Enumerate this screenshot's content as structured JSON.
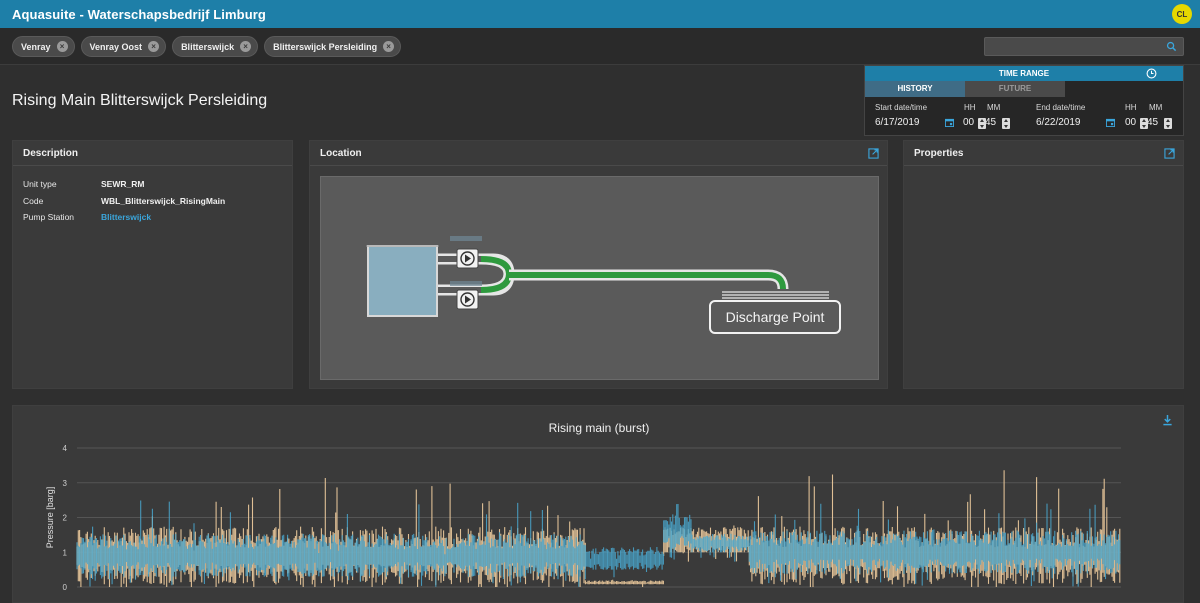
{
  "app": {
    "title": "Aquasuite - Waterschapsbedrijf Limburg",
    "user_initials": "CL"
  },
  "filters": {
    "chips": [
      "Venray",
      "Venray Oost",
      "Blitterswijck",
      "Blitterswijck Persleiding"
    ],
    "search_placeholder": ""
  },
  "page": {
    "title": "Rising Main Blitterswijck Persleiding"
  },
  "time_range": {
    "header": "TIME RANGE",
    "tabs": [
      "HISTORY",
      "FUTURE"
    ],
    "active_tab": "HISTORY",
    "start_label": "Start date/time",
    "end_label": "End date/time",
    "hh_label": "HH",
    "mm_label": "MM",
    "start_date": "6/17/2019",
    "start_hh": "00",
    "start_mm": "45",
    "end_date": "6/22/2019",
    "end_hh": "00",
    "end_mm": "45"
  },
  "description": {
    "header": "Description",
    "rows": [
      {
        "label": "Unit type",
        "value": "SEWR_RM"
      },
      {
        "label": "Code",
        "value": "WBL_Blitterswijck_RisingMain"
      },
      {
        "label": "Pump Station",
        "value": "Blitterswijck"
      }
    ]
  },
  "location": {
    "header": "Location",
    "discharge_label": "Discharge Point"
  },
  "properties": {
    "header": "Properties"
  },
  "colors": {
    "accent": "#1e7fa8",
    "link": "#3aa6dc",
    "pipe_green": "#2e9a3e",
    "series_blue": "#4aa8cf",
    "series_tan": "#e8c79a"
  },
  "chart_data": {
    "type": "line",
    "title": "Rising main (burst)",
    "ylabel": "Pressure [barg]",
    "xlabel": "",
    "ylim": [
      0,
      4
    ],
    "yticks": [
      0,
      1,
      2,
      3,
      4
    ],
    "grid": true,
    "series": [
      {
        "color": "#4aa8cf",
        "segments": [
          {
            "x_range": [
              0.0,
              0.487
            ],
            "mean": 0.9,
            "spread": 0.45,
            "spikes": 1.6,
            "floor": 0.3
          },
          {
            "x_range": [
              0.487,
              0.562
            ],
            "mean": 0.8,
            "spread": 0.25,
            "spikes": 0.4,
            "floor": 0.5
          },
          {
            "x_range": [
              0.562,
              0.589
            ],
            "mean": 1.6,
            "spread": 0.35,
            "spikes": 0.8,
            "floor": 1.0
          },
          {
            "x_range": [
              0.589,
              0.644
            ],
            "mean": 1.25,
            "spread": 0.2,
            "spikes": 0.3,
            "floor": 1.0
          },
          {
            "x_range": [
              0.644,
              1.0
            ],
            "mean": 1.0,
            "spread": 0.45,
            "spikes": 1.5,
            "floor": 0.3
          }
        ]
      },
      {
        "color": "#e8c79a",
        "segments": [
          {
            "x_range": [
              0.0,
              0.487
            ],
            "mean": 0.9,
            "spread": 0.6,
            "spikes": 2.4,
            "floor": 0.0
          },
          {
            "x_range": [
              0.487,
              0.562
            ],
            "mean": 0.12,
            "spread": 0.05,
            "spikes": 0.1,
            "floor": 0.08
          },
          {
            "x_range": [
              0.562,
              0.644
            ],
            "mean": 1.3,
            "spread": 0.3,
            "spikes": 0.5,
            "floor": 1.0
          },
          {
            "x_range": [
              0.644,
              1.0
            ],
            "mean": 0.9,
            "spread": 0.6,
            "spikes": 2.5,
            "floor": 0.0
          }
        ]
      }
    ]
  }
}
